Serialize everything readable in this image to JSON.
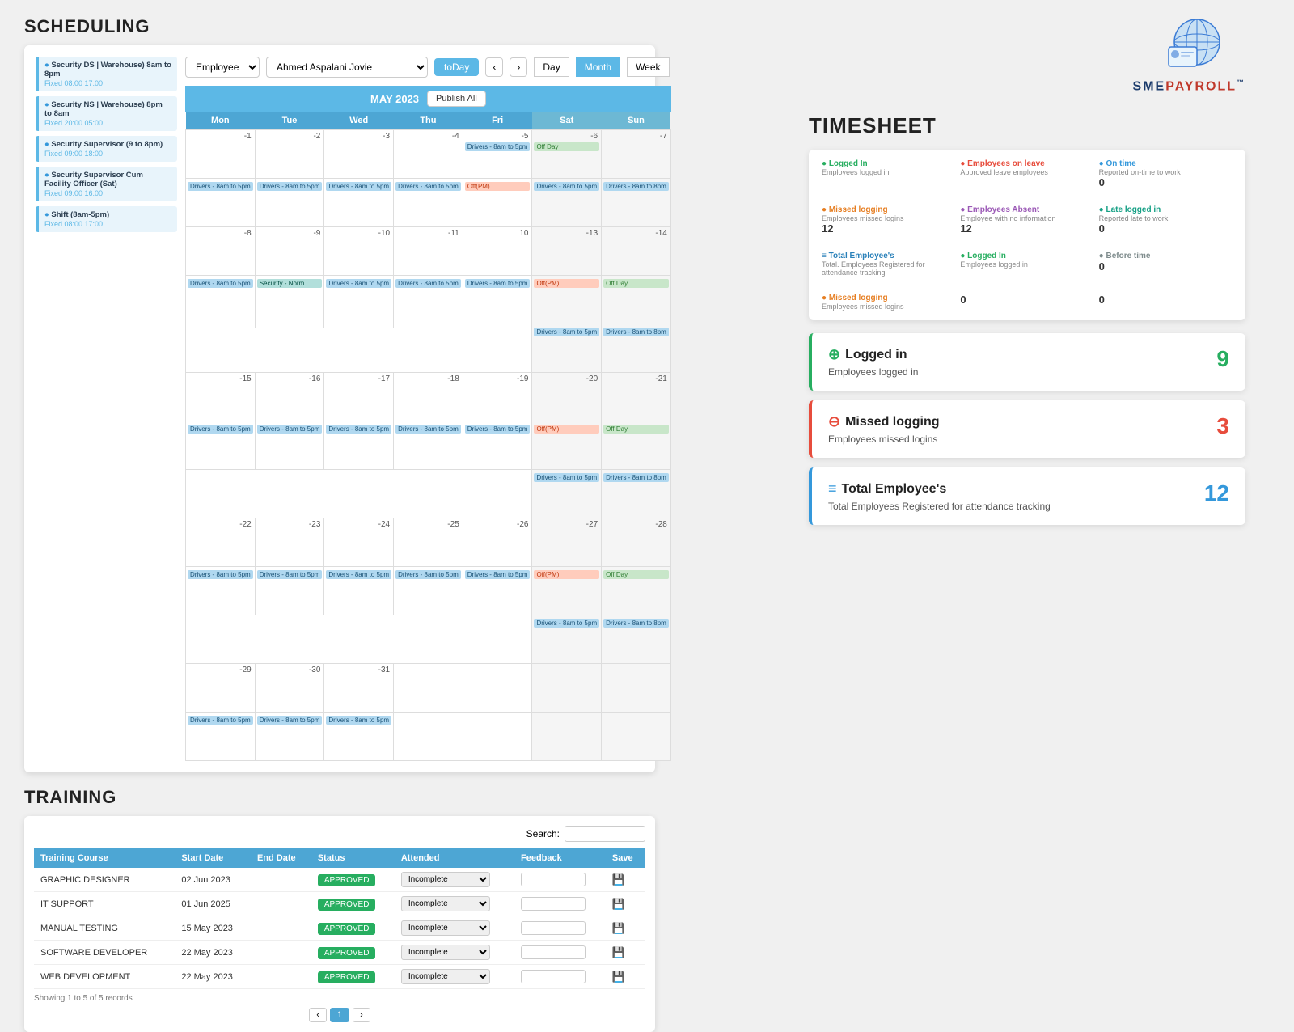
{
  "scheduling": {
    "title": "SCHEDULING",
    "toolbar": {
      "type_options": [
        "Employee"
      ],
      "type_selected": "Employee",
      "employee_name": "Ahmed Aspalani Jovie",
      "today_btn": "toDay",
      "day_btn": "Day",
      "month_btn": "Month",
      "week_btn": "Week"
    },
    "calendar": {
      "month_label": "MAY 2023",
      "publish_btn": "Publish All",
      "days": [
        "Mon",
        "Tue",
        "Wed",
        "Thu",
        "Fri",
        "Sat",
        "Sun"
      ]
    },
    "shift_list": [
      {
        "name": "Security DS | Warehouse) 8am to 8pm",
        "time": "Fixed 08:00 17:00"
      },
      {
        "name": "Security NS | Warehouse) 8pm to 8am",
        "time": "Fixed 20:00 05:00"
      },
      {
        "name": "Security Supervisor (9 to 8pm)",
        "time": "Fixed 09:00 18:00"
      },
      {
        "name": "Security Supervisor Cum Facility Officer (Sat)",
        "time": "Fixed 09:00 16:00"
      },
      {
        "name": "Shift (8am-5pm)",
        "time": "Fixed 08:00 17:00"
      }
    ]
  },
  "training": {
    "title": "TRAINING",
    "search_label": "Search:",
    "search_placeholder": "",
    "columns": [
      "Training Course",
      "Start Date",
      "End Date",
      "Status",
      "Attended",
      "Feedback",
      "Save"
    ],
    "rows": [
      {
        "course": "GRAPHIC DESIGNER",
        "start": "02 Jun 2023",
        "end": "",
        "status": "APPROVED",
        "attended": "Incomplete",
        "feedback": ""
      },
      {
        "course": "IT SUPPORT",
        "start": "01 Jun 2025",
        "end": "",
        "status": "APPROVED",
        "attended": "Incomplete",
        "feedback": ""
      },
      {
        "course": "MANUAL TESTING",
        "start": "15 May 2023",
        "end": "",
        "status": "APPROVED",
        "attended": "Incomplete",
        "feedback": ""
      },
      {
        "course": "SOFTWARE DEVELOPER",
        "start": "22 May 2023",
        "end": "",
        "status": "APPROVED",
        "attended": "Incomplete",
        "feedback": ""
      },
      {
        "course": "WEB DEVELOPMENT",
        "start": "22 May 2023",
        "end": "",
        "status": "APPROVED",
        "attended": "Incomplete",
        "feedback": ""
      }
    ],
    "footer": "Showing 1 to 5 of 5 records",
    "pagination": [
      "‹",
      "1",
      "›"
    ]
  },
  "timesheet": {
    "title": "TIMESHEET",
    "small_stats": [
      {
        "icon": "●",
        "icon_color": "green",
        "label": "Logged In",
        "sub": "Employees logged in",
        "value": ""
      },
      {
        "icon": "●",
        "icon_color": "red",
        "label": "Employees on leave",
        "sub": "Approved leave employees",
        "value": ""
      },
      {
        "icon": "●",
        "icon_color": "blue",
        "label": "On time",
        "sub": "Reported on-time to work",
        "value": "0"
      }
    ],
    "small_stats2": [
      {
        "icon": "●",
        "icon_color": "orange",
        "label": "Missed logging",
        "sub": "Employees missed logins",
        "value": "12"
      },
      {
        "icon": "●",
        "icon_color": "purple",
        "label": "Employees Absent",
        "sub": "Employee with no information",
        "value": "12"
      },
      {
        "icon": "●",
        "icon_color": "teal",
        "label": "Late logged in",
        "sub": "Reported late to work",
        "value": "0"
      }
    ],
    "small_stats3": [
      {
        "icon": "≡",
        "icon_color": "blue",
        "label": "Total Employee's",
        "sub": "Total. Employees Registered for attendance tracking",
        "value": ""
      },
      {
        "icon": "●",
        "icon_color": "green",
        "label": "Logged In",
        "sub": "Employees logged in",
        "value": ""
      },
      {
        "icon": "●",
        "icon_color": "blue",
        "label": "Before time",
        "sub": "",
        "value": "0"
      }
    ],
    "small_stats4": [
      {
        "icon": "●",
        "icon_color": "orange",
        "label": "Missed logging",
        "sub": "Employees missed logins",
        "value": ""
      },
      {
        "icon": "",
        "icon_color": "",
        "label": "",
        "sub": "",
        "value": "0"
      },
      {
        "icon": "",
        "icon_color": "",
        "label": "",
        "sub": "",
        "value": "0"
      }
    ],
    "highlight_cards": [
      {
        "type": "logged-in",
        "icon": "⊕",
        "title": "Logged in",
        "description": "Employees logged in",
        "value": "9",
        "value_color": "green"
      },
      {
        "type": "missed",
        "icon": "⊖",
        "title": "Missed logging",
        "description": "Employees missed logins",
        "value": "3",
        "value_color": "red"
      },
      {
        "type": "total",
        "icon": "≡",
        "title": "Total Employee's",
        "description": "Total Employees Registered for attendance tracking",
        "value": "12",
        "value_color": "blue"
      }
    ]
  },
  "logo": {
    "brand": "SMEPAYROLL",
    "tm": "™"
  }
}
